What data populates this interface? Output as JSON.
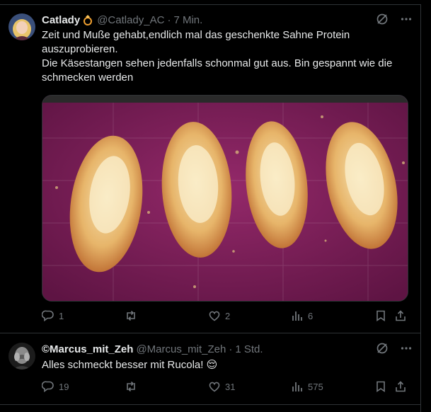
{
  "colors": {
    "background": "#000000",
    "text_primary": "#e7e9ea",
    "text_secondary": "#71767b",
    "divider": "#2f3336",
    "mat": "#7a1a55"
  },
  "tweets": [
    {
      "display_name": "Catlady",
      "badge_icon": "ring-icon",
      "handle": "@Catlady_AC",
      "separator": "·",
      "time": "7 Min.",
      "text_lines": [
        "Zeit und Muße gehabt,endlich mal das geschenkte Sahne Protein",
        "auszuprobieren.",
        "Die Käsestangen sehen jedenfalls schonmal gut aus. Bin gespannt wie die",
        "schmecken werden"
      ],
      "stats": {
        "replies": "1",
        "retweets": "",
        "likes": "2",
        "views": "6"
      }
    },
    {
      "display_name": "©Marcus_mit_Zeh",
      "handle": "@Marcus_mit_Zeh",
      "separator": "·",
      "time": "1 Std.",
      "text_lines": [
        "Alles schmeckt besser mit Rucola! 😌"
      ],
      "stats": {
        "replies": "19",
        "retweets": "",
        "likes": "31",
        "views": "575"
      }
    }
  ]
}
